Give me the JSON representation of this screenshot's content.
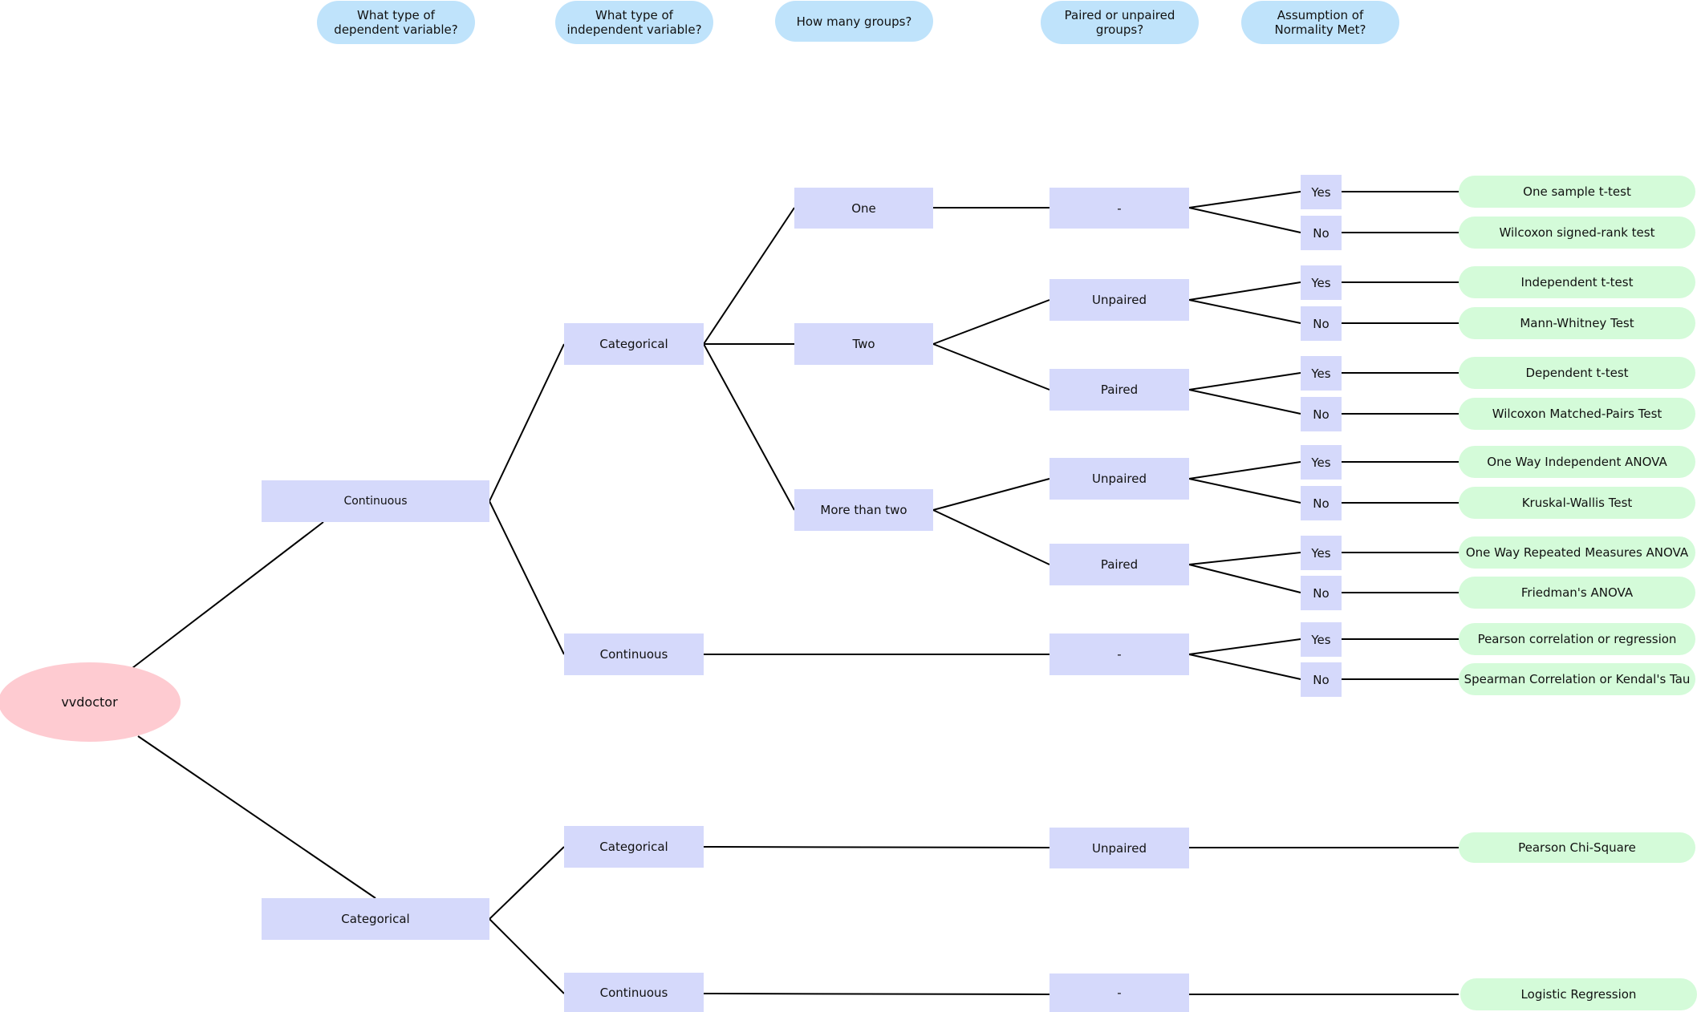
{
  "headers": [
    "What type of dependent variable?",
    "What type of independent variable?",
    "How many groups?",
    "Paired or unpaired groups?",
    "Assumption of Normality Met?"
  ],
  "root": "vvdoctor",
  "dependent": {
    "continuous": "Continuous",
    "categorical": "Categorical"
  },
  "independent": {
    "cont_categorical": "Categorical",
    "cont_continuous": "Continuous",
    "cat_categorical": "Categorical",
    "cat_continuous": "Continuous"
  },
  "groups": {
    "one": "One",
    "two": "Two",
    "more": "More than two"
  },
  "pairing": {
    "one_na": "-",
    "two_unpaired": "Unpaired",
    "two_paired": "Paired",
    "more_unpaired": "Unpaired",
    "more_paired": "Paired",
    "cont_na": "-",
    "cat_unpaired": "Unpaired",
    "catcont_na": "-"
  },
  "normality": [
    "Yes",
    "No",
    "Yes",
    "No",
    "Yes",
    "No",
    "Yes",
    "No",
    "Yes",
    "No",
    "Yes",
    "No"
  ],
  "results": [
    "One sample t-test",
    "Wilcoxon signed-rank test",
    "Independent t-test",
    "Mann-Whitney Test",
    "Dependent t-test",
    "Wilcoxon Matched-Pairs Test",
    "One Way Independent ANOVA",
    "Kruskal-Wallis Test",
    "One Way Repeated Measures ANOVA",
    "Friedman's ANOVA",
    "Pearson correlation or regression",
    "Spearman Correlation or Kendal's Tau"
  ],
  "results_categorical": {
    "chi_square": "Pearson Chi-Square",
    "logistic": "Logistic Regression"
  },
  "colors": {
    "question": "#bfe3fb",
    "node": "#d5d9fb",
    "result": "#d4fbd9",
    "root": "#fecbd1",
    "edge": "#000000"
  }
}
